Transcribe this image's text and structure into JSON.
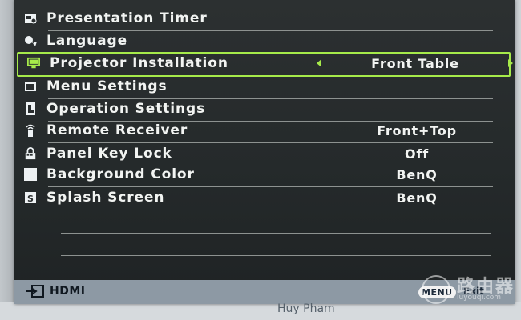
{
  "menu": {
    "items": [
      {
        "label": "Presentation Timer",
        "value": "",
        "icon": "timer-icon"
      },
      {
        "label": "Language",
        "value": "",
        "icon": "language-icon"
      },
      {
        "label": "Projector Installation",
        "value": "Front Table",
        "icon": "projector-icon",
        "selected": true
      },
      {
        "label": "Menu Settings",
        "value": "",
        "icon": "menu-settings-icon"
      },
      {
        "label": "Operation Settings",
        "value": "",
        "icon": "operation-settings-icon"
      },
      {
        "label": "Remote Receiver",
        "value": "Front+Top",
        "icon": "remote-receiver-icon"
      },
      {
        "label": "Panel Key Lock",
        "value": "Off",
        "icon": "lock-icon"
      },
      {
        "label": "Background Color",
        "value": "BenQ",
        "icon": "background-color-icon"
      },
      {
        "label": "Splash Screen",
        "value": "BenQ",
        "icon": "splash-screen-icon"
      }
    ]
  },
  "status": {
    "source_label": "HDMI",
    "menu_button_label": "MENU",
    "exit_label": "Exit"
  },
  "watermark": {
    "text": "路由器",
    "url": "luyouqi.com"
  },
  "caption": "Huy Pham",
  "colors": {
    "highlight": "#a6ea4a",
    "osd_background": "#2a2e2f",
    "status_bar": "#8d99a4"
  }
}
